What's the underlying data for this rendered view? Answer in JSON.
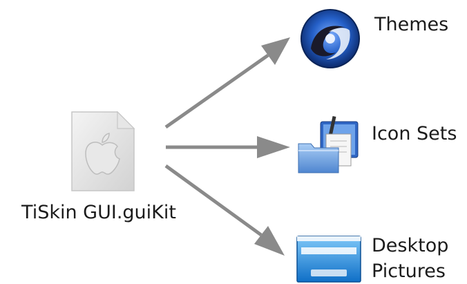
{
  "source_file": {
    "label": "TiSkin GUI.guiKit",
    "icon": "guikit-file-icon"
  },
  "targets": [
    {
      "label": "Themes",
      "icon": "themes-icon"
    },
    {
      "label": "Icon Sets",
      "icon": "icon-sets-icon"
    },
    {
      "label_line1": "Desktop",
      "label_line2": "Pictures",
      "icon": "desktop-pictures-icon"
    }
  ],
  "colors": {
    "arrow": "#8a8a8a",
    "themes_blue": "#1d4fa8",
    "folder_blue": "#6aa0e0",
    "desktop_blue": "#1789d8"
  }
}
